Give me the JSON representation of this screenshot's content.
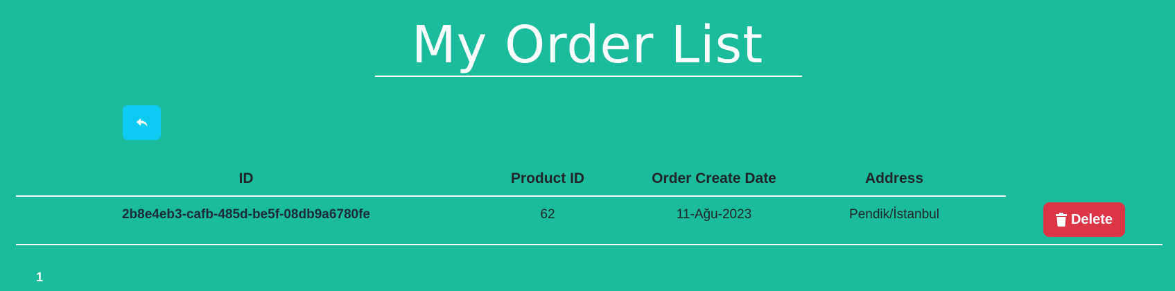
{
  "page": {
    "title": "My Order List"
  },
  "back_button": {
    "icon": "reply-icon"
  },
  "table": {
    "columns": [
      "ID",
      "Product ID",
      "Order Create Date",
      "Address"
    ],
    "rows": [
      {
        "id": "2b8e4eb3-cafb-485d-be5f-08db9a6780fe",
        "product_id": "62",
        "order_create_date": "11-Ağu-2023",
        "address": "Pendik/İstanbul",
        "delete_label": "Delete",
        "delete_icon": "trash-icon"
      }
    ]
  },
  "pagination": {
    "current_page": "1"
  },
  "colors": {
    "background": "#1abc9c",
    "back_button": "#0dcaf0",
    "delete_button": "#dc3545",
    "lines": "#ffffff"
  }
}
